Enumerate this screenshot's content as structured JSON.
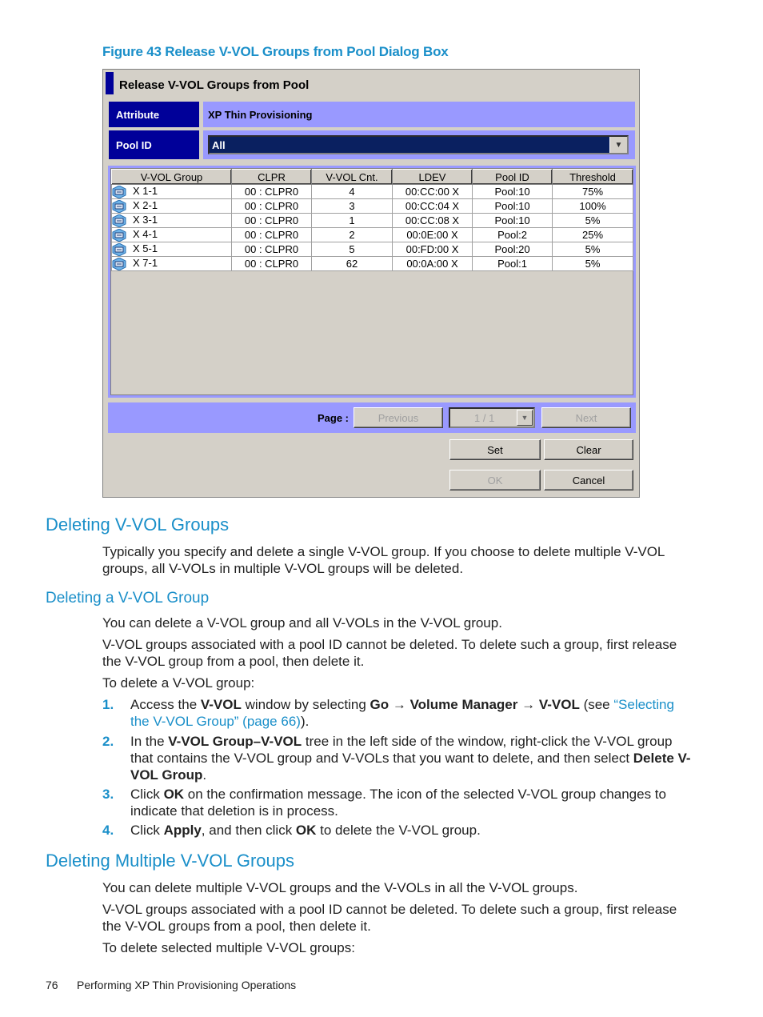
{
  "figure": {
    "caption": "Figure 43 Release V-VOL Groups from Pool Dialog Box"
  },
  "dialog": {
    "title": "Release V-VOL Groups from Pool",
    "attribute": {
      "label": "Attribute",
      "value": "XP Thin Provisioning"
    },
    "pool_id": {
      "label": "Pool ID",
      "selected": "All"
    },
    "table": {
      "columns": [
        "V-VOL Group",
        "CLPR",
        "V-VOL Cnt.",
        "LDEV",
        "Pool ID",
        "Threshold"
      ],
      "rows": [
        [
          "X 1-1",
          "00 : CLPR0",
          "4",
          "00:CC:00 X",
          "Pool:10",
          "75%"
        ],
        [
          "X 2-1",
          "00 : CLPR0",
          "3",
          "00:CC:04 X",
          "Pool:10",
          "100%"
        ],
        [
          "X 3-1",
          "00 : CLPR0",
          "1",
          "00:CC:08 X",
          "Pool:10",
          "5%"
        ],
        [
          "X 4-1",
          "00 : CLPR0",
          "2",
          "00:0E:00 X",
          "Pool:2",
          "25%"
        ],
        [
          "X 5-1",
          "00 : CLPR0",
          "5",
          "00:FD:00 X",
          "Pool:20",
          "5%"
        ],
        [
          "X 7-1",
          "00 : CLPR0",
          "62",
          "00:0A:00 X",
          "Pool:1",
          "5%"
        ]
      ]
    },
    "pager": {
      "label": "Page :",
      "previous": "Previous",
      "page_value": "1 / 1",
      "next": "Next"
    },
    "buttons": {
      "set": "Set",
      "clear": "Clear",
      "ok": "OK",
      "cancel": "Cancel"
    }
  },
  "doc": {
    "h_deleting_groups": "Deleting V-VOL Groups",
    "p_deleting_groups": "Typically you specify and delete a single V-VOL group. If you choose to delete multiple V-VOL groups, all V-VOLs in multiple V-VOL groups will be deleted.",
    "h_deleting_a_group": "Deleting a V-VOL Group",
    "p1": "You can delete a V-VOL group and all V-VOLs in the V-VOL group.",
    "p2": "V-VOL groups associated with a pool ID cannot be deleted. To delete such a group, first release the V-VOL group from a pool, then delete it.",
    "p3": "To delete a V-VOL group:",
    "steps": {
      "s1": {
        "num": "1.",
        "a": "Access the ",
        "b1": "V-VOL",
        "c": " window by selecting ",
        "b2": "Go",
        "arrow1": " → ",
        "b3": "Volume Manager",
        "arrow2": " → ",
        "b4": "V-VOL",
        "d": " (see ",
        "link": "“Selecting the V-VOL Group” (page 66)",
        "e": ")."
      },
      "s2": {
        "num": "2.",
        "a": "In the ",
        "b1": "V-VOL Group–V-VOL",
        "c": " tree in the left side of the window, right-click the V-VOL group that contains the V-VOL group and V-VOLs that you want to delete, and then select ",
        "b2": "Delete V-VOL Group",
        "d": "."
      },
      "s3": {
        "num": "3.",
        "a": "Click ",
        "b1": "OK",
        "c": " on the confirmation message. The icon of the selected V-VOL group changes to indicate that deletion is in process."
      },
      "s4": {
        "num": "4.",
        "a": "Click ",
        "b1": "Apply",
        "c": ", and then click ",
        "b2": "OK",
        "d": " to delete the V-VOL group."
      }
    },
    "h_deleting_multiple": "Deleting Multiple V-VOL Groups",
    "m1": "You can delete multiple V-VOL groups and the V-VOLs in all the V-VOL groups.",
    "m2": "V-VOL groups associated with a pool ID cannot be deleted. To delete such a group, first release the V-VOL groups from a pool, then delete it.",
    "m3": "To delete selected multiple V-VOL groups:"
  },
  "footer": {
    "page_number": "76",
    "section": "Performing XP Thin Provisioning Operations"
  }
}
